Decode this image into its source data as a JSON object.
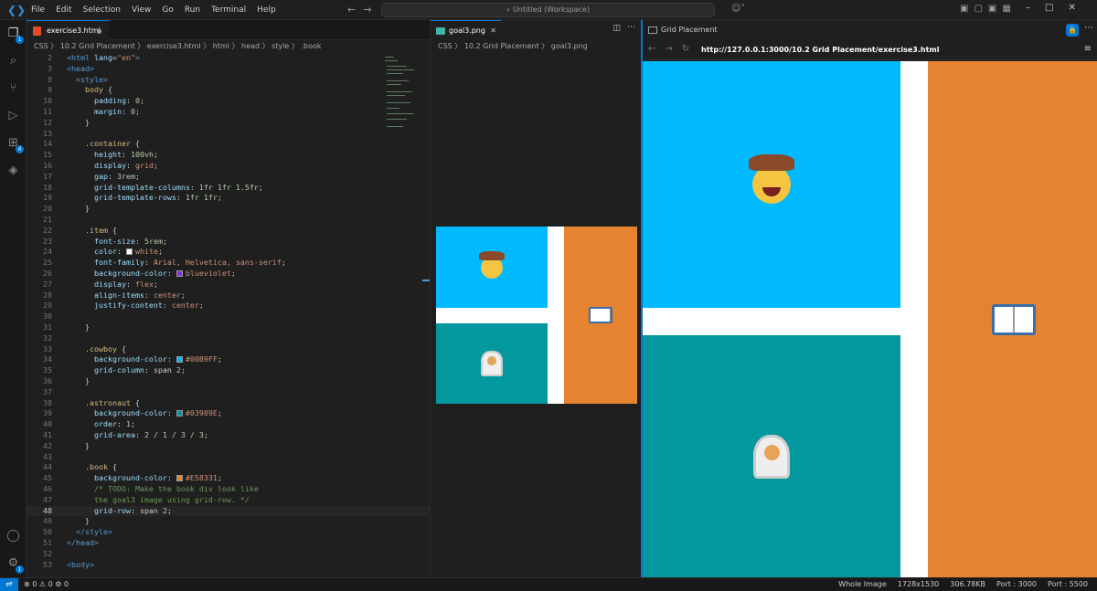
{
  "titlebar": {
    "menu": [
      "File",
      "Edit",
      "Selection",
      "View",
      "Go",
      "Run",
      "Terminal",
      "Help"
    ],
    "search": "Untitled (Workspace)"
  },
  "activity": {
    "explorer_badge": "1",
    "extensions_badge": "4",
    "settings_badge": "1"
  },
  "editor": {
    "tab": "exercise3.html",
    "breadcrumb": "CSS 〉 10.2 Grid Placement 〉 exercise3.html 〉 html 〉 head 〉 style 〉 .book",
    "lines": [
      {
        "n": "2",
        "html": "<span class='t-tag'>&lt;html</span> <span class='t-attr'>lang</span>=<span class='t-str'>\"en\"</span><span class='t-tag'>&gt;</span>"
      },
      {
        "n": "3",
        "html": "<span class='t-tag'>&lt;head&gt;</span>"
      },
      {
        "n": "8",
        "html": "  <span class='t-tag'>&lt;style&gt;</span>"
      },
      {
        "n": "9",
        "html": "    <span class='t-sel'>body</span> {"
      },
      {
        "n": "10",
        "html": "      <span class='t-prop'>padding</span>: <span class='t-num'>0</span>;"
      },
      {
        "n": "11",
        "html": "      <span class='t-prop'>margin</span>: <span class='t-num'>0</span>;"
      },
      {
        "n": "12",
        "html": "    }"
      },
      {
        "n": "13",
        "html": ""
      },
      {
        "n": "14",
        "html": "    <span class='t-sel'>.container</span> {"
      },
      {
        "n": "15",
        "html": "      <span class='t-prop'>height</span>: <span class='t-num'>100vh</span>;"
      },
      {
        "n": "16",
        "html": "      <span class='t-prop'>display</span>: <span class='t-kw'>grid</span>;"
      },
      {
        "n": "17",
        "html": "      <span class='t-prop'>gap</span>: <span class='t-num'>3rem</span>;"
      },
      {
        "n": "18",
        "html": "      <span class='t-prop'>grid-template-columns</span>: <span class='t-num'>1fr 1fr 1.5fr</span>;"
      },
      {
        "n": "19",
        "html": "      <span class='t-prop'>grid-template-rows</span>: <span class='t-num'>1fr 1fr</span>;"
      },
      {
        "n": "20",
        "html": "    }"
      },
      {
        "n": "21",
        "html": ""
      },
      {
        "n": "22",
        "html": "    <span class='t-sel'>.item</span> {"
      },
      {
        "n": "23",
        "html": "      <span class='t-prop'>font-size</span>: <span class='t-num'>5rem</span>;"
      },
      {
        "n": "24",
        "html": "      <span class='t-prop'>color</span>: <span class='sw' style='background:#fff'></span><span class='t-kw'>white</span>;"
      },
      {
        "n": "25",
        "html": "      <span class='t-prop'>font-family</span>: <span class='t-kw'>Arial, Helvetica, sans-serif</span>;"
      },
      {
        "n": "26",
        "html": "      <span class='t-prop'>background-color</span>: <span class='sw' style='background:#8a2be2'></span><span class='t-kw'>blueviolet</span>;"
      },
      {
        "n": "27",
        "html": "      <span class='t-prop'>display</span>: <span class='t-kw'>flex</span>;"
      },
      {
        "n": "28",
        "html": "      <span class='t-prop'>align-items</span>: <span class='t-kw'>center</span>;"
      },
      {
        "n": "29",
        "html": "      <span class='t-prop'>justify-content</span>: <span class='t-kw'>center</span>;"
      },
      {
        "n": "30",
        "html": ""
      },
      {
        "n": "31",
        "html": "    }"
      },
      {
        "n": "32",
        "html": ""
      },
      {
        "n": "33",
        "html": "    <span class='t-sel'>.cowboy</span> {"
      },
      {
        "n": "34",
        "html": "      <span class='t-prop'>background-color</span>: <span class='sw' style='background:#00B9FF'></span><span class='t-kw'>#00B9FF</span>;"
      },
      {
        "n": "35",
        "html": "      <span class='t-prop'>grid-column</span>: span <span class='t-num'>2</span>;"
      },
      {
        "n": "36",
        "html": "    }"
      },
      {
        "n": "37",
        "html": ""
      },
      {
        "n": "38",
        "html": "    <span class='t-sel'>.astronaut</span> {"
      },
      {
        "n": "39",
        "html": "      <span class='t-prop'>background-color</span>: <span class='sw' style='background:#03989E'></span><span class='t-kw'>#03989E</span>;"
      },
      {
        "n": "40",
        "html": "      <span class='t-prop'>order</span>: <span class='t-num'>1</span>;"
      },
      {
        "n": "41",
        "html": "      <span class='t-prop'>grid-area</span>: <span class='t-num'>2 / 1 / 3 / 3</span>;"
      },
      {
        "n": "42",
        "html": "    }"
      },
      {
        "n": "43",
        "html": ""
      },
      {
        "n": "44",
        "html": "    <span class='t-sel'>.book</span> {"
      },
      {
        "n": "45",
        "html": "      <span class='t-prop'>background-color</span>: <span class='sw' style='background:#E58331'></span><span class='t-kw'>#E58331</span>;"
      },
      {
        "n": "46",
        "html": "      <span class='t-com'>/* TODO: Make the book div look like</span>"
      },
      {
        "n": "47",
        "html": "<span class='t-com'>      the goal3 image using grid-row. */</span>"
      },
      {
        "n": "48",
        "html": "      <span class='t-prop'>grid-row</span>: span <span class='t-num'>2</span>;"
      },
      {
        "n": "49",
        "html": "    }"
      },
      {
        "n": "50",
        "html": "  <span class='t-tag'>&lt;/style&gt;</span>"
      },
      {
        "n": "51",
        "html": "<span class='t-tag'>&lt;/head&gt;</span>"
      },
      {
        "n": "52",
        "html": ""
      },
      {
        "n": "53",
        "html": "<span class='t-tag'>&lt;body&gt;</span>"
      }
    ]
  },
  "image_viewer": {
    "tab": "goal3.png",
    "breadcrumb": "CSS 〉 10.2 Grid Placement 〉 goal3.png"
  },
  "browser": {
    "tab": "Grid Placement",
    "url": "http://127.0.0.1:3000/10.2 Grid Placement/exercise3.html"
  },
  "colors": {
    "cowboy": "#00B9FF",
    "astronaut": "#03989E",
    "book": "#E58331"
  },
  "status": {
    "problems": "⊗ 0  ⚠ 0",
    "ports": "⚙ 0",
    "right": [
      "Whole Image",
      "1728x1530",
      "306.78KB",
      "Port : 3000",
      "Port : 5500"
    ]
  }
}
